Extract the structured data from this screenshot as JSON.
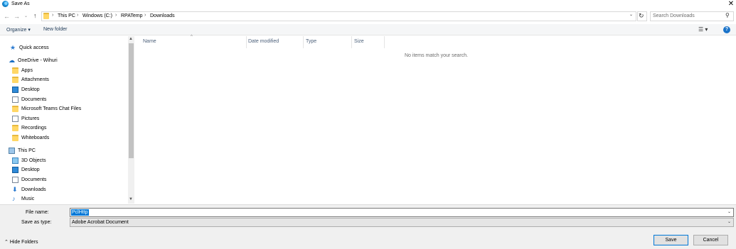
{
  "window": {
    "title": "Save As",
    "close_glyph": "✕"
  },
  "address": {
    "crumbs": [
      "This PC",
      "Windows (C:)",
      "RPATemp",
      "Downloads"
    ],
    "search_placeholder": "Search Downloads"
  },
  "toolbar": {
    "organize_label": "Organize ▾",
    "new_folder_label": "New folder",
    "help_glyph": "?"
  },
  "nav": {
    "items": [
      {
        "label": "Quick access",
        "icon": "star-icon"
      },
      {
        "label": "OneDrive - Wihuri",
        "icon": "cloud-icon"
      },
      {
        "label": "Apps",
        "icon": "folder-icon"
      },
      {
        "label": "Attachments",
        "icon": "folder-icon"
      },
      {
        "label": "Desktop",
        "icon": "desktop-icon"
      },
      {
        "label": "Documents",
        "icon": "document-icon"
      },
      {
        "label": "Microsoft Teams Chat Files",
        "icon": "folder-icon"
      },
      {
        "label": "Pictures",
        "icon": "pictures-icon"
      },
      {
        "label": "Recordings",
        "icon": "folder-icon"
      },
      {
        "label": "Whiteboards",
        "icon": "folder-icon"
      },
      {
        "label": "This PC",
        "icon": "pc-icon"
      },
      {
        "label": "3D Objects",
        "icon": "3d-objects-icon"
      },
      {
        "label": "Desktop",
        "icon": "desktop-icon"
      },
      {
        "label": "Documents",
        "icon": "document-icon"
      },
      {
        "label": "Downloads",
        "icon": "download-icon"
      },
      {
        "label": "Music",
        "icon": "music-icon"
      }
    ]
  },
  "file_list": {
    "columns": [
      "Name",
      "Date modified",
      "Type",
      "Size"
    ],
    "empty_message": "No items match your search."
  },
  "form": {
    "file_name_label": "File name:",
    "file_name_value": "PclHttp",
    "save_as_type_label": "Save as type:",
    "save_as_type_value": "Adobe Acrobat Document"
  },
  "footer": {
    "hide_folders_label": "Hide Folders",
    "save_label": "Save",
    "cancel_label": "Cancel"
  },
  "colors": {
    "accent": "#0078d7",
    "folder": "#ffd766"
  }
}
